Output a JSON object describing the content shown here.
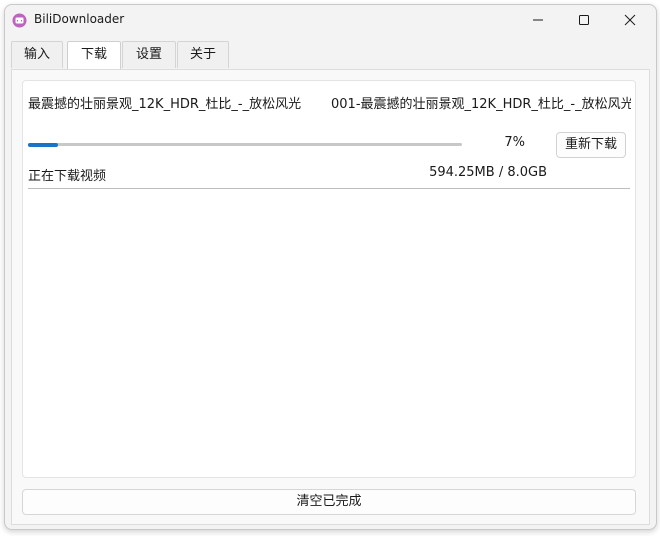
{
  "window": {
    "title": "BiliDownloader",
    "icon": "bili-app-icon"
  },
  "tabs": [
    {
      "label": "输入",
      "active": false
    },
    {
      "label": "下载",
      "active": true
    },
    {
      "label": "设置",
      "active": false
    },
    {
      "label": "关于",
      "active": false
    }
  ],
  "downloads": [
    {
      "title": "最震撼的壮丽景观_12K_HDR_杜比_-_放松风光",
      "file": "001-最震撼的壮丽景观_12K_HDR_杜比_-_放松风光",
      "progress": 0.07,
      "percent_text": "7%",
      "redownload_label": "重新下载",
      "status": "正在下载视频",
      "size_text": "594.25MB / 8.0GB"
    }
  ],
  "clear_button": "清空已完成",
  "colors": {
    "accent": "#1a73c8"
  }
}
